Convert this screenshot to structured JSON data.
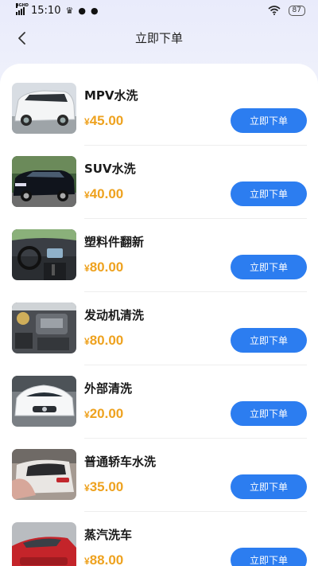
{
  "status_bar": {
    "network": "4GHD",
    "time": "15:10",
    "battery": "87"
  },
  "header": {
    "title": "立即下单"
  },
  "services": [
    {
      "name": "MPV水洗",
      "currency": "¥",
      "price": "45.00",
      "button": "立即下单",
      "thumb": "mpv-car-image"
    },
    {
      "name": "SUV水洗",
      "currency": "¥",
      "price": "40.00",
      "button": "立即下单",
      "thumb": "suv-car-image"
    },
    {
      "name": "塑料件翻新",
      "currency": "¥",
      "price": "80.00",
      "button": "立即下单",
      "thumb": "car-interior-image"
    },
    {
      "name": "发动机清洗",
      "currency": "¥",
      "price": "80.00",
      "button": "立即下单",
      "thumb": "engine-bay-image"
    },
    {
      "name": "外部清洗",
      "currency": "¥",
      "price": "20.00",
      "button": "立即下单",
      "thumb": "white-sedan-image"
    },
    {
      "name": "普通轿车水洗",
      "currency": "¥",
      "price": "35.00",
      "button": "立即下单",
      "thumb": "car-rear-image"
    },
    {
      "name": "蒸汽洗车",
      "currency": "¥",
      "price": "88.00",
      "button": "立即下单",
      "thumb": "red-car-image"
    }
  ],
  "colors": {
    "price": "#eea21f",
    "button": "#2c7df0",
    "header_bg": "#eef0fb"
  }
}
